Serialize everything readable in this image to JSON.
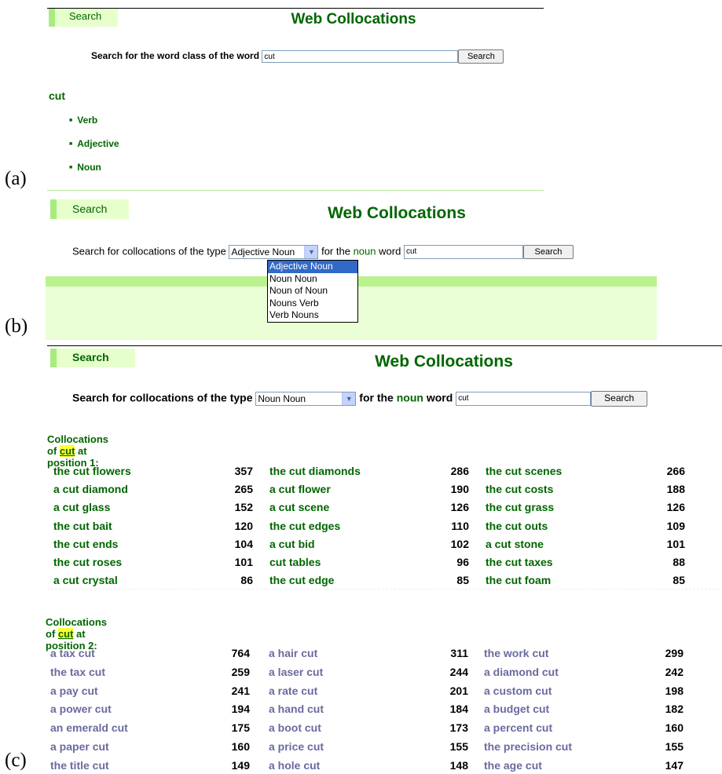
{
  "labels": {
    "a": "(a)",
    "b": "(b)",
    "c": "(c)"
  },
  "panel_a": {
    "tab": "Search",
    "title": "Web Collocations",
    "prompt": "Search for the word class of the word",
    "input_value": "cut",
    "button": "Search",
    "word": "cut",
    "classes": [
      "Verb",
      "Adjective",
      "Noun"
    ]
  },
  "panel_b": {
    "tab": "Search",
    "title": "Web Collocations",
    "prompt_1": "Search for collocations of the type",
    "selected_type": "Adjective Noun",
    "prompt_2": "for the",
    "word_class": "noun",
    "prompt_3": "word",
    "input_value": "cut",
    "button": "Search",
    "options": [
      "Adjective Noun",
      "Noun Noun",
      "Noun of Noun",
      "Nouns Verb",
      "Verb Nouns"
    ]
  },
  "panel_c": {
    "tab": "Search",
    "title": "Web Collocations",
    "prompt_1": "Search for collocations of the type",
    "selected_type": "Noun Noun",
    "prompt_2": "for the",
    "word_class": "noun",
    "prompt_3": "word",
    "input_value": "cut",
    "button": "Search",
    "section1": {
      "head_pre": "Collocations of",
      "head_word": "cut",
      "head_post": "at position 1:",
      "rows": [
        [
          [
            "the cut flowers",
            "357"
          ],
          [
            "the cut diamonds",
            "286"
          ],
          [
            "the cut scenes",
            "266"
          ]
        ],
        [
          [
            "a cut diamond",
            "265"
          ],
          [
            "a cut flower",
            "190"
          ],
          [
            "the cut costs",
            "188"
          ]
        ],
        [
          [
            "a cut glass",
            "152"
          ],
          [
            "a cut scene",
            "126"
          ],
          [
            "the cut grass",
            "126"
          ]
        ],
        [
          [
            "the cut bait",
            "120"
          ],
          [
            "the cut edges",
            "110"
          ],
          [
            "the cut outs",
            "109"
          ]
        ],
        [
          [
            "the cut ends",
            "104"
          ],
          [
            "a cut bid",
            "102"
          ],
          [
            "a cut stone",
            "101"
          ]
        ],
        [
          [
            "the cut roses",
            "101"
          ],
          [
            "cut tables",
            "96"
          ],
          [
            "the cut taxes",
            "88"
          ]
        ],
        [
          [
            "a cut crystal",
            "86"
          ],
          [
            "the cut edge",
            "85"
          ],
          [
            "the cut foam",
            "85"
          ]
        ]
      ]
    },
    "section2": {
      "head_pre": "Collocations of",
      "head_word": "cut",
      "head_post": "at position 2:",
      "rows": [
        [
          [
            "a tax cut",
            "764"
          ],
          [
            "a hair cut",
            "311"
          ],
          [
            "the work cut",
            "299"
          ]
        ],
        [
          [
            "the tax cut",
            "259"
          ],
          [
            "a laser cut",
            "244"
          ],
          [
            "a diamond cut",
            "242"
          ]
        ],
        [
          [
            "a pay cut",
            "241"
          ],
          [
            "a rate cut",
            "201"
          ],
          [
            "a custom cut",
            "198"
          ]
        ],
        [
          [
            "a power cut",
            "194"
          ],
          [
            "a hand cut",
            "184"
          ],
          [
            "a budget cut",
            "182"
          ]
        ],
        [
          [
            "an emerald cut",
            "175"
          ],
          [
            "a boot cut",
            "173"
          ],
          [
            "a percent cut",
            "160"
          ]
        ],
        [
          [
            "a paper cut",
            "160"
          ],
          [
            "a price cut",
            "155"
          ],
          [
            "the precision cut",
            "155"
          ]
        ],
        [
          [
            "the title cut",
            "149"
          ],
          [
            "a hole cut",
            "148"
          ],
          [
            "the age cut",
            "147"
          ]
        ]
      ]
    }
  },
  "colors": {
    "accent_green": "#006600",
    "tab_bg": "#e6ffcc",
    "tab_border": "#a8ec80",
    "link_purple": "#6a6aa0",
    "highlight": "#ffff33"
  }
}
